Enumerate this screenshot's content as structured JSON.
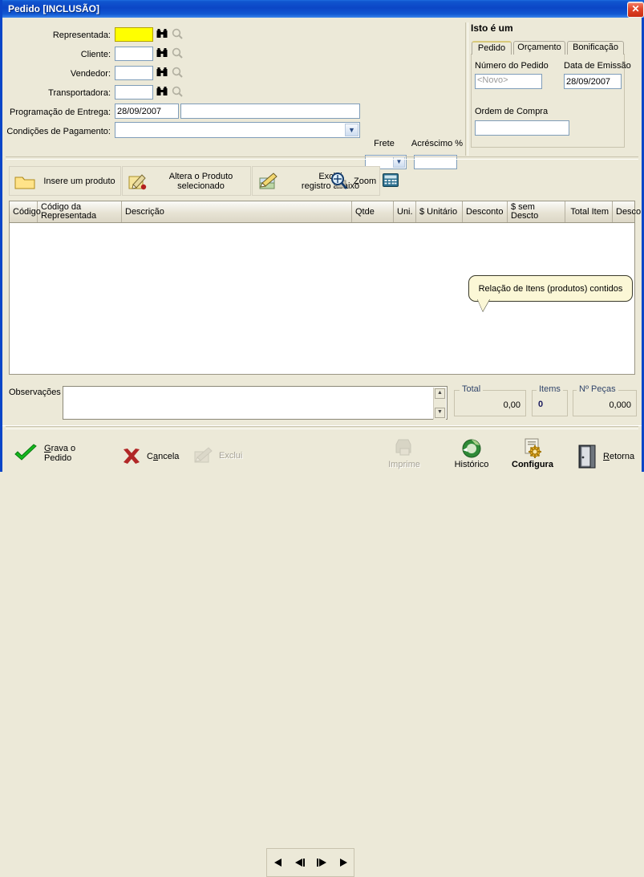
{
  "window": {
    "title": "Pedido [INCLUSÃO]",
    "close_label": "✕",
    "accent_color": "#0a46c8",
    "face_color": "#ece9d8"
  },
  "form": {
    "fields": [
      {
        "label": "Representada:",
        "value": "",
        "highlight": true,
        "icons": [
          "binoculars-icon",
          "magnifier-icon"
        ]
      },
      {
        "label": "Cliente:",
        "value": "",
        "highlight": false,
        "icons": [
          "binoculars-icon",
          "magnifier-icon"
        ]
      },
      {
        "label": "Vendedor:",
        "value": "",
        "highlight": false,
        "icons": [
          "binoculars-icon",
          "magnifier-icon"
        ]
      },
      {
        "label": "Transportadora:",
        "value": "",
        "highlight": false,
        "icons": [
          "binoculars-icon",
          "magnifier-icon"
        ]
      }
    ],
    "delivery_label": "Programação de Entrega:",
    "delivery_date": "28/09/2007",
    "delivery_extra": "",
    "payment_label": "Condições de Pagamento:",
    "payment_value": "",
    "freight_label": "Frete",
    "freight_value": "",
    "surcharge_label": "Acréscimo %",
    "surcharge_value": ""
  },
  "right_panel": {
    "title": "Isto é um",
    "tabs": [
      {
        "label": "Pedido",
        "active": true
      },
      {
        "label": "Orçamento",
        "active": false
      },
      {
        "label": "Bonificação",
        "active": false
      }
    ],
    "order_number_label": "Número do Pedido",
    "order_number_value": "<Novo>",
    "issue_date_label": "Data de Emissão",
    "issue_date_value": "28/09/2007",
    "purchase_order_label": "Ordem de Compra",
    "purchase_order_value": ""
  },
  "toolbar": {
    "buttons": [
      {
        "label": "Insere um produto",
        "icon": "folder-icon",
        "enabled": true
      },
      {
        "label": "Altera o Produto\nselecionado",
        "line1": "Altera o Produto",
        "line2": "selecionado",
        "icon": "edit-pencil-icon",
        "enabled": true
      },
      {
        "label": "Exclui\nregistro abaixo",
        "line1": "Exclui",
        "line2": "registro abaixo",
        "icon": "delete-pencil-icon",
        "enabled": true
      },
      {
        "label": "Zoom",
        "icon": "magnifier-plus-icon",
        "enabled": true
      },
      {
        "label": "",
        "icon": "calculator-icon",
        "enabled": true
      }
    ]
  },
  "grid": {
    "columns": [
      {
        "header": "Código",
        "align": "left"
      },
      {
        "header": "Código da\nRepresentada",
        "line1": "Código da",
        "line2": "Representada",
        "align": "left"
      },
      {
        "header": "Descrição",
        "align": "left"
      },
      {
        "header": "Qtde",
        "align": "left"
      },
      {
        "header": "Uni.",
        "align": "left"
      },
      {
        "header": "$ Unitário",
        "align": "left"
      },
      {
        "header": "Desconto",
        "align": "left"
      },
      {
        "header": "$ sem Descto",
        "align": "left"
      },
      {
        "header": "Total Item",
        "align": "right"
      },
      {
        "header": "Desco",
        "align": "left"
      }
    ],
    "rows": [],
    "callout": "Relação de Itens (produtos) contidos"
  },
  "bottom": {
    "observations_label": "Observações",
    "observations_value": "",
    "total_label": "Total",
    "total_value": "0,00",
    "items_label": "Items",
    "items_value": "0",
    "pieces_label": "Nº Peças",
    "pieces_value": "0,000"
  },
  "actions": {
    "save_line1": "Grava o",
    "save_line2": "Pedido",
    "cancel_label": "Cancela",
    "delete_label": "Exclui",
    "print_label": "Imprime",
    "history_label": "Histórico",
    "config_label": "Configura",
    "return_label": "Retorna",
    "nav": [
      {
        "name": "first-record",
        "glyph": "◀"
      },
      {
        "name": "previous-record",
        "glyph": "◀|"
      },
      {
        "name": "next-record",
        "glyph": "|▶"
      },
      {
        "name": "last-record",
        "glyph": "▶"
      }
    ]
  }
}
